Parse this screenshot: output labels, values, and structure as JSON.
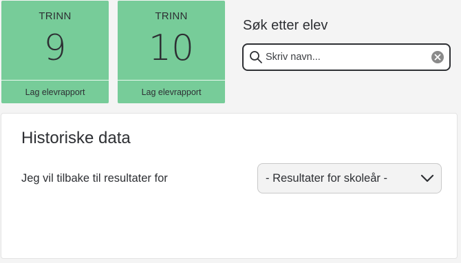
{
  "tiles": [
    {
      "label": "TRINN",
      "number": "9",
      "action": "Lag elevrapport"
    },
    {
      "label": "TRINN",
      "number": "10",
      "action": "Lag elevrapport"
    }
  ],
  "search": {
    "title": "Søk etter elev",
    "placeholder": "Skriv navn...",
    "value": ""
  },
  "history": {
    "title": "Historiske data",
    "label": "Jeg vil tilbake til resultater for",
    "select_value": "- Resultater for skoleår -"
  },
  "colors": {
    "tile_bg": "#77cc99",
    "text": "#2d2f33",
    "page_bg": "#f4f4f4"
  },
  "icons": {
    "search": "search-icon",
    "clear": "clear-icon",
    "dropdown": "chevron-down-icon"
  }
}
